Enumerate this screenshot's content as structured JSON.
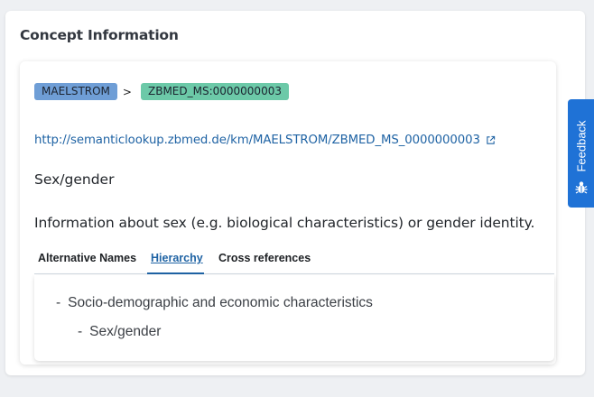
{
  "panel": {
    "title": "Concept Information"
  },
  "breadcrumb": {
    "source": "MAELSTROM",
    "separator": ">",
    "term": "ZBMED_MS:0000000003"
  },
  "iri": {
    "text": "http://semanticlookup.zbmed.de/km/MAELSTROM/ZBMED_MS_0000000003",
    "icon": "external-link-icon"
  },
  "concept": {
    "label": "Sex/gender",
    "description": "Information about sex (e.g. biological characteristics) or gender identity."
  },
  "tabs": [
    {
      "label": "Alternative Names",
      "active": false
    },
    {
      "label": "Hierarchy",
      "active": true
    },
    {
      "label": "Cross references",
      "active": false
    }
  ],
  "hierarchy": [
    {
      "marker": "-",
      "label": "Socio-demographic and economic characteristics",
      "level": 1
    },
    {
      "marker": "-",
      "label": "Sex/gender",
      "level": 2
    }
  ],
  "feedback": {
    "label": "Feedback",
    "icon": "bug-icon"
  },
  "colors": {
    "source_badge": "#6f9ed6",
    "term_badge": "#6cc9a8",
    "link": "#1f63a4",
    "feedback_button": "#1f72d6"
  }
}
